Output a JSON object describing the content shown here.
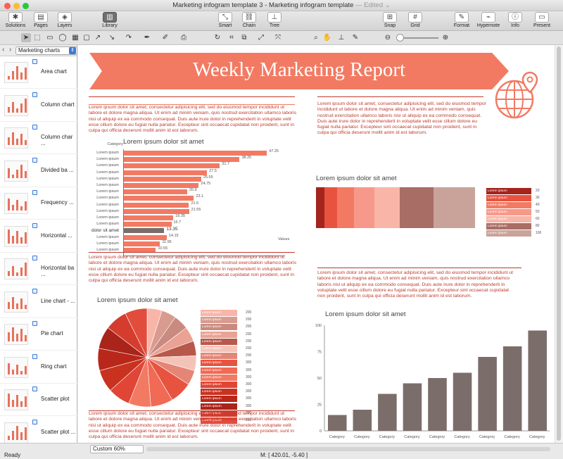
{
  "window": {
    "title": "Marketing infogram template 3 - Marketing infogram template",
    "edited": "— Edited ⌄"
  },
  "toolbar": {
    "solutions": "Solutions",
    "pages": "Pages",
    "layers": "Layers",
    "library": "Library",
    "smart": "Smart",
    "chain": "Chain",
    "tree": "Tree",
    "snap": "Snap",
    "grid": "Grid",
    "format": "Format",
    "hypernote": "Hypernote",
    "info": "Info",
    "present": "Present"
  },
  "sidebar": {
    "category": "Marketing charts",
    "items": [
      {
        "label": "Area chart"
      },
      {
        "label": "Column chart"
      },
      {
        "label": "Column char ..."
      },
      {
        "label": "Divided ba ..."
      },
      {
        "label": "Frequency ..."
      },
      {
        "label": "Horizontal ..."
      },
      {
        "label": "Horizontal ba ..."
      },
      {
        "label": "Line chart - ..."
      },
      {
        "label": "Pie chart"
      },
      {
        "label": "Ring chart"
      },
      {
        "label": "Scatter plot"
      },
      {
        "label": "Scatter plot ..."
      }
    ]
  },
  "doc": {
    "banner": "Weekly Marketing Report",
    "lorem1": "Lorem ipsum dolor sit amet, consectetur adipisicing elit, sed do eiusmod tempor incididunt ut labore et dolore magna aliqua. Ut enim ad minim veniam, quis nostrud exercitation ullamco laboris nisi ut aliquip ex ea commodo consequat. Duis aute irure dolor in reprehenderit in voluptate velit esse cillum dolore eu fugiat nulla pariatur. Excepteur sint occaecat cupidatat non proident, sunt in culpa qui officia deserunt mollit anim id est laborum.",
    "hbar_title": "Lorem ipsum dolor sit amet",
    "stack_title": "Lorem ipsum dolor sit amet",
    "pie_title": "Lorem ipsum dolor sit amet",
    "col_title": "Lorem ipsum dolor sit amet",
    "hbar_category": "Category",
    "hbar_values": "Values",
    "legend_label": "Lorem ipsum",
    "col_category": "Category"
  },
  "status": {
    "zoom": "Custom 60%",
    "ready": "Ready",
    "mouse": "M: [ 420.01, -5.40 ]"
  },
  "chart_data": [
    {
      "type": "bar",
      "orientation": "horizontal",
      "title": "Lorem ipsum dolor sit amet",
      "xlabel": "Values",
      "ylabel": "Category",
      "categories": [
        "Lorem ipsum",
        "Lorem ipsum",
        "Lorem ipsum",
        "Lorem ipsum",
        "Lorem ipsum",
        "Lorem ipsum",
        "Lorem ipsum",
        "Lorem ipsum",
        "Lorem ipsum",
        "Lorem ipsum",
        "Lorem ipsum",
        "Lorem ipsum",
        "dolor sit amet",
        "Lorem ipsum",
        "Lorem ipsum",
        "Lorem ipsum"
      ],
      "values": [
        47.25,
        38.25,
        31.7,
        27.5,
        25.55,
        24.75,
        20.9,
        23.1,
        21.5,
        21.55,
        16.35,
        15.7,
        13.35,
        14.15,
        11.95,
        10.55
      ],
      "highlight_index": 12,
      "colors": [
        "#f27a63",
        "#7b6e6a"
      ]
    },
    {
      "type": "bar",
      "orientation": "stacked-100",
      "title": "Lorem ipsum dolor sit amet",
      "legend": [
        {
          "name": "Lorem ipsum",
          "value": 20,
          "color": "#a5241c"
        },
        {
          "name": "Lorem ipsum",
          "value": 30,
          "color": "#e8533f"
        },
        {
          "name": "Lorem ipsum",
          "value": 40,
          "color": "#f27a63"
        },
        {
          "name": "Lorem ipsum",
          "value": 50,
          "color": "#f7998a"
        },
        {
          "name": "Lorem ipsum",
          "value": 60,
          "color": "#f9b5a8"
        },
        {
          "name": "Lorem ipsum",
          "value": 80,
          "color": "#a86d65"
        },
        {
          "name": "Lorem ipsum",
          "value": 100,
          "color": "#c9a39a"
        }
      ]
    },
    {
      "type": "pie",
      "title": "Lorem ipsum dolor sit amet",
      "legend_values": [
        200,
        200,
        200,
        200,
        200,
        200,
        200,
        300,
        300,
        300,
        300,
        300,
        300,
        300,
        300,
        300
      ]
    },
    {
      "type": "bar",
      "title": "Lorem ipsum dolor sit amet",
      "ylim": [
        0,
        100
      ],
      "yticks": [
        0,
        25,
        50,
        75,
        100
      ],
      "categories": [
        "Category",
        "Category",
        "Category",
        "Category",
        "Category",
        "Category",
        "Category",
        "Category",
        "Category"
      ],
      "values": [
        15,
        20,
        35,
        45,
        50,
        55,
        70,
        80,
        95
      ],
      "color": "#7b6e6a"
    }
  ]
}
